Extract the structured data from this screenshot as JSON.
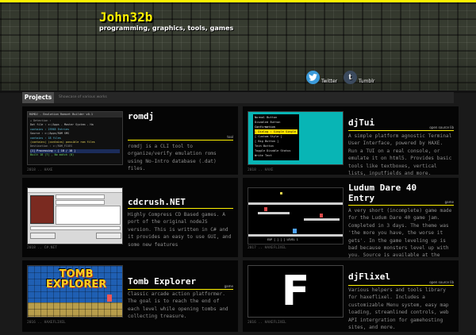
{
  "site": {
    "title": "John32b",
    "subtitle": "programming, graphics, tools, games",
    "accent_color": "#fff200"
  },
  "social": [
    {
      "label": "Twitter",
      "icon": "twitter-bird-icon"
    },
    {
      "label": "Tumblr",
      "icon": "tumblr-t-icon"
    }
  ],
  "tabs": {
    "active_label": "Projects",
    "caption": "Showcase of various works"
  },
  "projects": [
    {
      "title": "romdj",
      "tag": "tool",
      "date": "2018 .. HAXE",
      "description": "romdj is a CLI tool to organize/verify emulation roms using No-Intro database (.dat) files.",
      "thumb": {
        "heading": "ROMDJ - Emulation Romset Builder v0.1",
        "lines": [
          "+ Detection :",
          "Dat file : c:/Apps - Master System - Ha",
          "  contains : 23965 Entries",
          "Source : c:/Apps/ROM SMS",
          "  contains : 18 files",
          "(contains) (contains) possible rom files",
          "Destination : c:/ROM_FIXES",
          "[1] Processing : [ 18 / 18 ]",
          "Built 18 (?) , No match (0)"
        ]
      }
    },
    {
      "title": "djTui",
      "tag": "open source lib",
      "date": "2018 .. HAXE",
      "description": "A simple platform agnostic Terminal User Interface, powered by HAXE. Run a TUI on a real console, or emulate it on html5. Provides basic tools like textboxes, vertical lists, inputfields and more.",
      "thumb": {
        "lines": [
          "Normal Button",
          "Disabled Button",
          "Confirmation",
          "[ Dialog : Single Single ]",
          "[ Custom Style ]",
          "[ Big Button ]",
          "Tech Button",
          "Toggle Disable Status",
          "Write Text"
        ]
      }
    },
    {
      "title": "cdcrush.NET",
      "tag": "",
      "date": "2018 .. C#.NET",
      "description": "Highly Compress CD Based games. A port of the original nodeJS version. This is written in C# and it provides an easy to use GUI, and some new features"
    },
    {
      "title": "Ludum Dare 40 Entry",
      "tag": "game",
      "date": "2017 .. HAXEFLIXEL",
      "description": "A very short (incomplete) game made for the Ludum Dare 40 game jam. Completed in 3 days. The theme was 'the more you have, the worse it gets'. In the game leveling up is bad because monsters level up with you. Source is available at the game page",
      "thumb": {
        "hud": "EXP [ ] [ ] LEVEL 1"
      }
    },
    {
      "title": "Tomb Explorer",
      "tag": "game",
      "date": "2016 .. HAXEFLIXEL",
      "description": "Classic arcade action platformer. The goal is to reach the end of each level while opening tombs and collecting treasure.",
      "thumb": {
        "logo_line1": "TOMB",
        "logo_line2": "EXPLORER"
      }
    },
    {
      "title": "djFlixel",
      "tag": "open source lib",
      "date": "2016 .. HAXEFLIXEL",
      "description": "Various helpers and tools library for haxeflixel. Includes a customizable Menu system, easy map loading, streamlined controls, web API intergration for gamehosting sites, and more.",
      "thumb": {
        "letter": "F"
      }
    }
  ]
}
